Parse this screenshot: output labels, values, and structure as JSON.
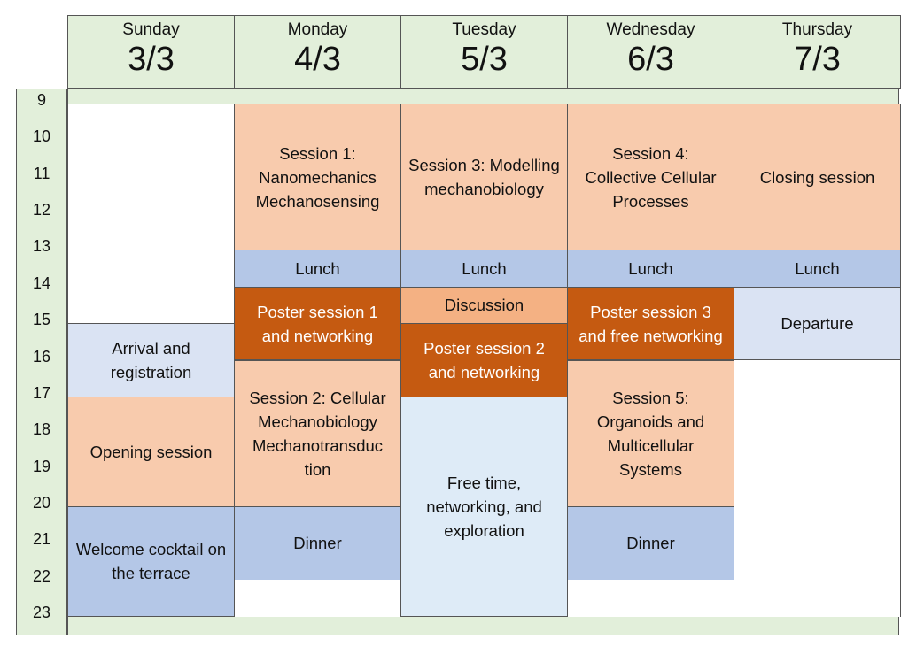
{
  "hours": [
    "9",
    "10",
    "11",
    "12",
    "13",
    "14",
    "15",
    "16",
    "17",
    "18",
    "19",
    "20",
    "21",
    "22",
    "23"
  ],
  "colors": {
    "header": "#e2efda",
    "session": "#f8cbad",
    "meal": "#b4c7e7",
    "poster": "#c55a11",
    "discussion": "#f4b183",
    "light": "#dae3f3",
    "free": "#deebf7",
    "empty": "#ffffff"
  },
  "days": [
    {
      "name": "Sunday",
      "date": "3/3",
      "events": [
        {
          "label": "",
          "start": 9,
          "end": 15,
          "kind": "empty"
        },
        {
          "label": "Arrival and registration",
          "start": 15,
          "end": 17,
          "kind": "light"
        },
        {
          "label": "Opening session",
          "start": 17,
          "end": 20,
          "kind": "session"
        },
        {
          "label": "Welcome cocktail on the terrace",
          "start": 20,
          "end": 23,
          "kind": "meal"
        }
      ]
    },
    {
      "name": "Monday",
      "date": "4/3",
      "events": [
        {
          "label": "Session 1: Nanomechanics Mechanosensing",
          "start": 9,
          "end": 13,
          "kind": "session"
        },
        {
          "label": "Lunch",
          "start": 13,
          "end": 14,
          "kind": "meal"
        },
        {
          "label": "Poster session 1 and networking",
          "start": 14,
          "end": 16,
          "kind": "poster"
        },
        {
          "label": "Session 2: Cellular Mechanobiology Mechanotransduc tion",
          "start": 16,
          "end": 20,
          "kind": "session"
        },
        {
          "label": "Dinner",
          "start": 20,
          "end": 22,
          "kind": "meal"
        },
        {
          "label": "",
          "start": 22,
          "end": 23,
          "kind": "empty"
        }
      ]
    },
    {
      "name": "Tuesday",
      "date": "5/3",
      "events": [
        {
          "label": "Session 3: Modelling mechanobiology",
          "start": 9,
          "end": 13,
          "kind": "session"
        },
        {
          "label": "Lunch",
          "start": 13,
          "end": 14,
          "kind": "meal"
        },
        {
          "label": "Discussion",
          "start": 14,
          "end": 15,
          "kind": "discussion"
        },
        {
          "label": "Poster session 2 and networking",
          "start": 15,
          "end": 17,
          "kind": "poster"
        },
        {
          "label": "Free time, networking, and exploration",
          "start": 17,
          "end": 23,
          "kind": "free"
        }
      ]
    },
    {
      "name": "Wednesday",
      "date": "6/3",
      "events": [
        {
          "label": "Session 4: Collective Cellular Processes",
          "start": 9,
          "end": 13,
          "kind": "session"
        },
        {
          "label": "Lunch",
          "start": 13,
          "end": 14,
          "kind": "meal"
        },
        {
          "label": "Poster session 3 and free networking",
          "start": 14,
          "end": 16,
          "kind": "poster"
        },
        {
          "label": "Session 5: Organoids and Multicellular Systems",
          "start": 16,
          "end": 20,
          "kind": "session"
        },
        {
          "label": "Dinner",
          "start": 20,
          "end": 22,
          "kind": "meal"
        },
        {
          "label": "",
          "start": 22,
          "end": 23,
          "kind": "empty"
        }
      ]
    },
    {
      "name": "Thursday",
      "date": "7/3",
      "events": [
        {
          "label": "Closing session",
          "start": 9,
          "end": 13,
          "kind": "session"
        },
        {
          "label": "Lunch",
          "start": 13,
          "end": 14,
          "kind": "meal"
        },
        {
          "label": "Departure",
          "start": 14,
          "end": 16,
          "kind": "light"
        },
        {
          "label": "",
          "start": 16,
          "end": 23,
          "kind": "empty"
        }
      ]
    }
  ]
}
